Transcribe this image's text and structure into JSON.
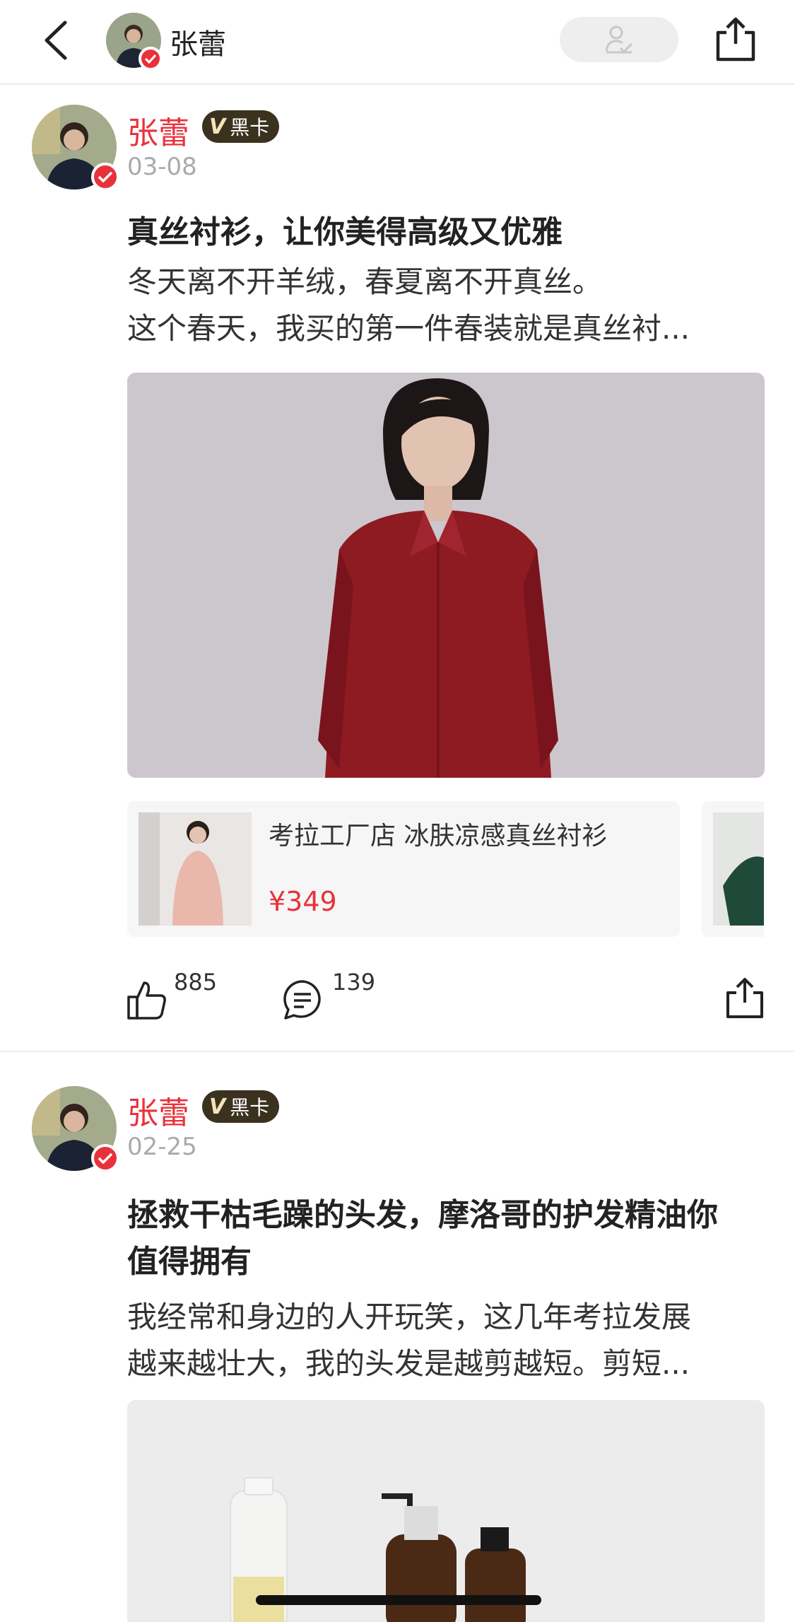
{
  "header": {
    "name": "张蕾",
    "follow_icon": "person-check-icon",
    "back_icon": "chevron-left-icon",
    "share_icon": "share-upload-icon"
  },
  "posts": [
    {
      "author": "张蕾",
      "badge_v": "V",
      "badge_label": "黑卡",
      "date": "03-08",
      "title": "真丝衬衫，让你美得高级又优雅",
      "body_line1": "冬天离不开羊绒，春夏离不开真丝。",
      "body_line2": "这个春天，我买的第一件春装就是真丝衬...",
      "product": {
        "name": "考拉工厂店 冰肤凉感真丝衬衫",
        "price": "¥349"
      },
      "likes": "885",
      "comments": "139"
    },
    {
      "author": "张蕾",
      "badge_v": "V",
      "badge_label": "黑卡",
      "date": "02-25",
      "title_line1": "拯救干枯毛躁的头发，摩洛哥的护发精油你",
      "title_line2": "值得拥有",
      "body_line1": "我经常和身边的人开玩笑，这几年考拉发展",
      "body_line2": "越来越壮大，我的头发是越剪越短。剪短..."
    }
  ],
  "colors": {
    "accent": "#e8323b",
    "badge_bg": "#3a321f",
    "shirt": "#8e1a22",
    "photo_bg": "#ccc7cd"
  }
}
